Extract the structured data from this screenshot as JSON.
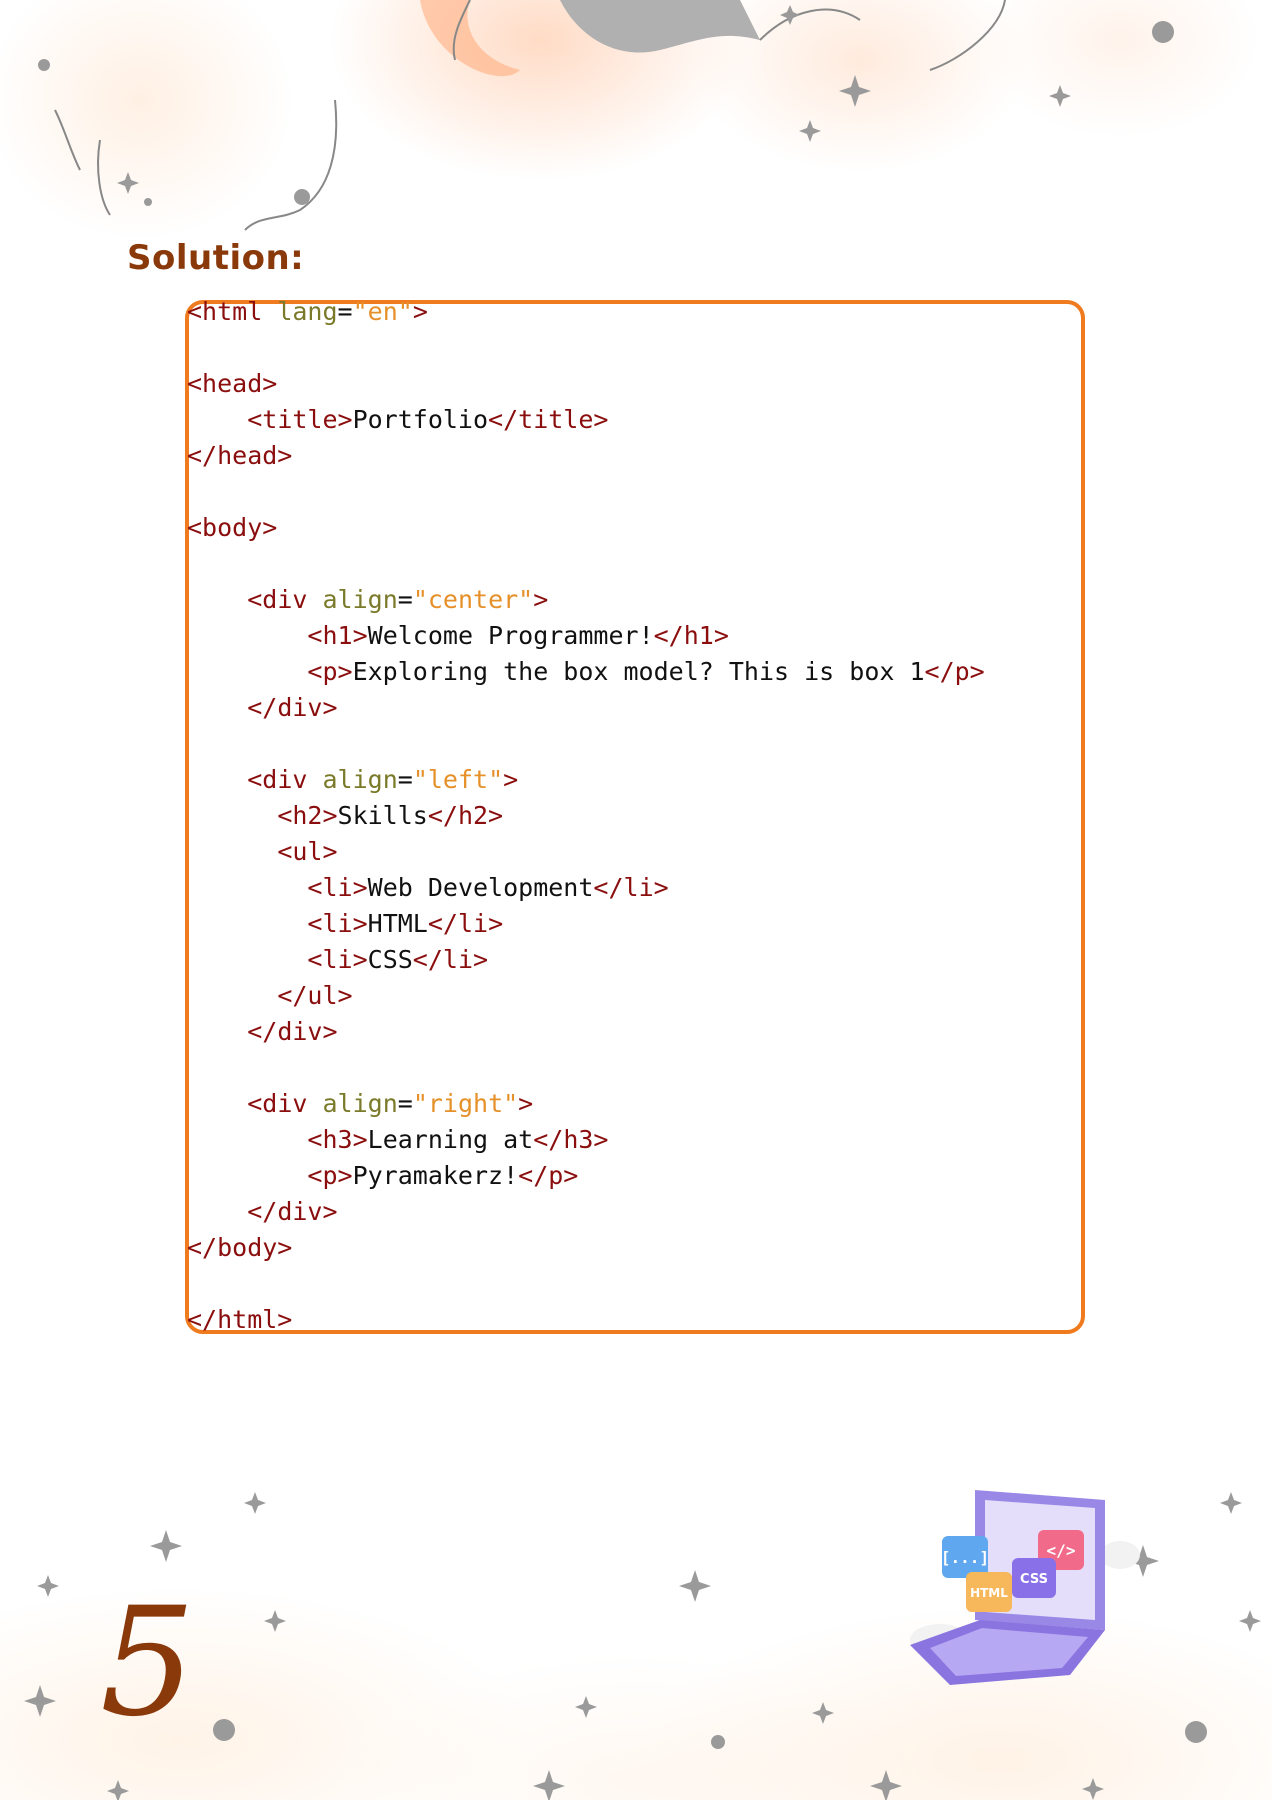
{
  "heading": "Solution:",
  "code_lines": [
    [
      {
        "t": "tag",
        "v": "<html "
      },
      {
        "t": "attr",
        "v": "lang"
      },
      {
        "t": "txt",
        "v": "="
      },
      {
        "t": "val",
        "v": "\"en\""
      },
      {
        "t": "tag",
        "v": ">"
      }
    ],
    [],
    [
      {
        "t": "tag",
        "v": "<head>"
      }
    ],
    [
      {
        "t": "txt",
        "v": "    "
      },
      {
        "t": "tag",
        "v": "<title>"
      },
      {
        "t": "txt",
        "v": "Portfolio"
      },
      {
        "t": "tag",
        "v": "</title>"
      }
    ],
    [
      {
        "t": "tag",
        "v": "</head>"
      }
    ],
    [],
    [
      {
        "t": "tag",
        "v": "<body>"
      }
    ],
    [],
    [
      {
        "t": "txt",
        "v": "    "
      },
      {
        "t": "tag",
        "v": "<div "
      },
      {
        "t": "attr",
        "v": "align"
      },
      {
        "t": "txt",
        "v": "="
      },
      {
        "t": "val",
        "v": "\"center\""
      },
      {
        "t": "tag",
        "v": ">"
      }
    ],
    [
      {
        "t": "txt",
        "v": "        "
      },
      {
        "t": "tag",
        "v": "<h1>"
      },
      {
        "t": "txt",
        "v": "Welcome Programmer!"
      },
      {
        "t": "tag",
        "v": "</h1>"
      }
    ],
    [
      {
        "t": "txt",
        "v": "        "
      },
      {
        "t": "tag",
        "v": "<p>"
      },
      {
        "t": "txt",
        "v": "Exploring the box model? This is box 1"
      },
      {
        "t": "tag",
        "v": "</p>"
      }
    ],
    [
      {
        "t": "txt",
        "v": "    "
      },
      {
        "t": "tag",
        "v": "</div>"
      }
    ],
    [],
    [
      {
        "t": "txt",
        "v": "    "
      },
      {
        "t": "tag",
        "v": "<div "
      },
      {
        "t": "attr",
        "v": "align"
      },
      {
        "t": "txt",
        "v": "="
      },
      {
        "t": "val",
        "v": "\"left\""
      },
      {
        "t": "tag",
        "v": ">"
      }
    ],
    [
      {
        "t": "txt",
        "v": "      "
      },
      {
        "t": "tag",
        "v": "<h2>"
      },
      {
        "t": "txt",
        "v": "Skills"
      },
      {
        "t": "tag",
        "v": "</h2>"
      }
    ],
    [
      {
        "t": "txt",
        "v": "      "
      },
      {
        "t": "tag",
        "v": "<ul>"
      }
    ],
    [
      {
        "t": "txt",
        "v": "        "
      },
      {
        "t": "tag",
        "v": "<li>"
      },
      {
        "t": "txt",
        "v": "Web Development"
      },
      {
        "t": "tag",
        "v": "</li>"
      }
    ],
    [
      {
        "t": "txt",
        "v": "        "
      },
      {
        "t": "tag",
        "v": "<li>"
      },
      {
        "t": "txt",
        "v": "HTML"
      },
      {
        "t": "tag",
        "v": "</li>"
      }
    ],
    [
      {
        "t": "txt",
        "v": "        "
      },
      {
        "t": "tag",
        "v": "<li>"
      },
      {
        "t": "txt",
        "v": "CSS"
      },
      {
        "t": "tag",
        "v": "</li>"
      }
    ],
    [
      {
        "t": "txt",
        "v": "      "
      },
      {
        "t": "tag",
        "v": "</ul>"
      }
    ],
    [
      {
        "t": "txt",
        "v": "    "
      },
      {
        "t": "tag",
        "v": "</div>"
      }
    ],
    [],
    [
      {
        "t": "txt",
        "v": "    "
      },
      {
        "t": "tag",
        "v": "<div "
      },
      {
        "t": "attr",
        "v": "align"
      },
      {
        "t": "txt",
        "v": "="
      },
      {
        "t": "val",
        "v": "\"right\""
      },
      {
        "t": "tag",
        "v": ">"
      }
    ],
    [
      {
        "t": "txt",
        "v": "        "
      },
      {
        "t": "tag",
        "v": "<h3>"
      },
      {
        "t": "txt",
        "v": "Learning at"
      },
      {
        "t": "tag",
        "v": "</h3>"
      }
    ],
    [
      {
        "t": "txt",
        "v": "        "
      },
      {
        "t": "tag",
        "v": "<p>"
      },
      {
        "t": "txt",
        "v": "Pyramakerz!"
      },
      {
        "t": "tag",
        "v": "</p>"
      }
    ],
    [
      {
        "t": "txt",
        "v": "    "
      },
      {
        "t": "tag",
        "v": "</div>"
      }
    ],
    [
      {
        "t": "tag",
        "v": "</body>"
      }
    ],
    [],
    [
      {
        "t": "tag",
        "v": "</html>"
      }
    ]
  ],
  "page_number": "5",
  "illustration": {
    "icons": [
      "brackets-icon",
      "html-icon",
      "css-icon",
      "code-icon"
    ],
    "labels": {
      "brackets": "[...]",
      "html": "HTML",
      "css": "CSS",
      "code": "</>"
    }
  },
  "colors": {
    "heading": "#8a3a0a",
    "border": "#f07a1e",
    "tag": "#8b0e0e",
    "attr": "#7a7a2a",
    "value": "#e6902a"
  }
}
